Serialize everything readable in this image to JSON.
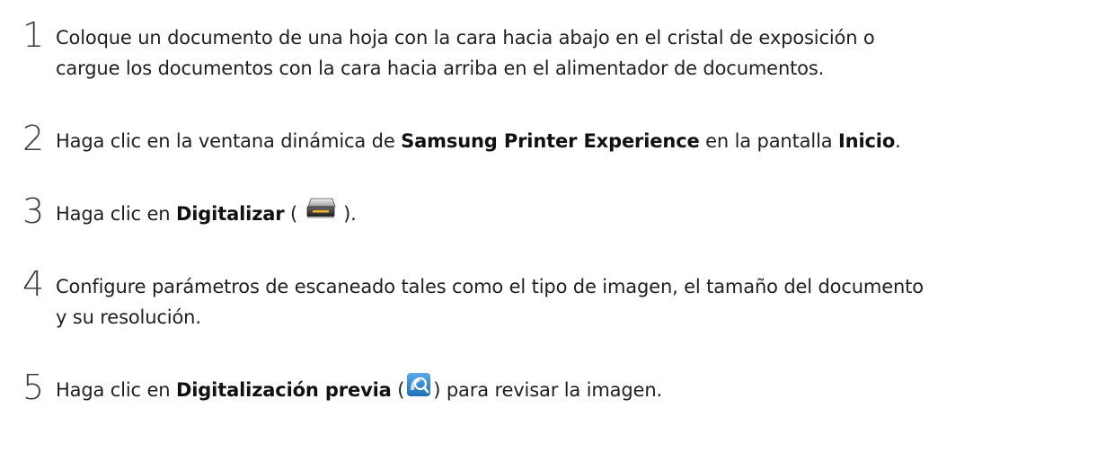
{
  "steps": [
    {
      "number": "1",
      "line1": "Coloque un documento de una hoja con la cara hacia abajo en el cristal de exposición o",
      "line2": "cargue los documentos con la cara hacia arriba en el alimentador de documentos."
    },
    {
      "number": "2",
      "pre": "Haga clic en la ventana dinámica de ",
      "bold1": "Samsung Printer Experience",
      "mid": " en la pantalla ",
      "bold2": "Inicio",
      "post": "."
    },
    {
      "number": "3",
      "pre": "Haga clic en ",
      "bold": "Digitalizar",
      "open": " ( ",
      "close": " ).",
      "icon": "scanner-icon"
    },
    {
      "number": "4",
      "line1": "Configure parámetros de escaneado tales como el tipo de imagen, el tamaño del documento",
      "line2": "y su resolución."
    },
    {
      "number": "5",
      "pre": "Haga clic en ",
      "bold": "Digitalización previa",
      "open": " (",
      "close": ") para revisar la imagen.",
      "icon": "preview-scan-icon"
    }
  ],
  "colors": {
    "text": "#1f1f1f",
    "number": "#3c3c3c",
    "preview_icon": "#2a7fc9"
  }
}
